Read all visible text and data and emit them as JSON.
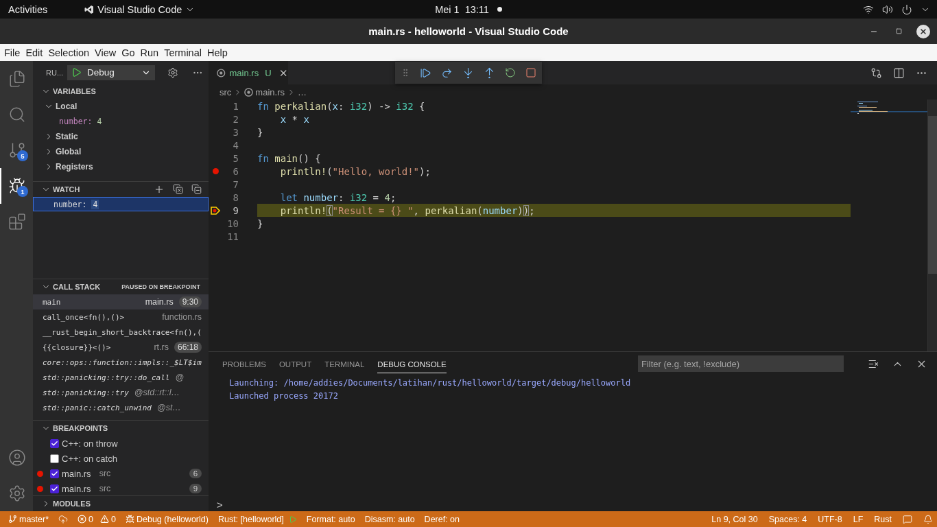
{
  "topbar": {
    "activities": "Activities",
    "app": "Visual Studio Code",
    "clock": "Mei 1  13:11"
  },
  "window": {
    "title": "main.rs - helloworld - Visual Studio Code"
  },
  "menu": [
    "File",
    "Edit",
    "Selection",
    "View",
    "Go",
    "Run",
    "Terminal",
    "Help"
  ],
  "activity_bar": [
    {
      "kind": "explorer",
      "selected": false
    },
    {
      "kind": "search",
      "selected": false
    },
    {
      "kind": "scm",
      "selected": false,
      "badge": "5"
    },
    {
      "kind": "debug",
      "selected": true,
      "badge": "1"
    },
    {
      "kind": "extensions",
      "selected": false
    }
  ],
  "sidebar": {
    "run_label": "RU...",
    "config": "Debug",
    "variables": {
      "title": "VARIABLES",
      "expanded": true,
      "scopes": [
        {
          "label": "Local",
          "expanded": true,
          "children": [
            {
              "name": "number:",
              "value": "4"
            }
          ]
        },
        {
          "label": "Static",
          "expanded": false
        },
        {
          "label": "Global",
          "expanded": false
        },
        {
          "label": "Registers",
          "expanded": false
        }
      ]
    },
    "watch": {
      "title": "WATCH",
      "expanded": true,
      "items": [
        {
          "name": "number:",
          "value": "4",
          "selected": true
        }
      ]
    },
    "call_stack": {
      "title": "CALL STACK",
      "expanded": true,
      "status": "PAUSED ON BREAKPOINT",
      "frames": [
        {
          "kind": "user",
          "name": "main",
          "file": "main.rs",
          "pos": "9:30",
          "selected": true
        },
        {
          "kind": "user",
          "name": "call_once<fn(),()>",
          "file": "function.rs",
          "selected": false
        },
        {
          "kind": "user",
          "name": "__rust_begin_short_backtrace<fn(),(",
          "selected": false
        },
        {
          "kind": "user",
          "name": "{{closure}}<()>",
          "file": "rt.rs",
          "pos": "66:18",
          "selected": false
        },
        {
          "kind": "external",
          "name": "core::ops::function::impls::_$LT$im",
          "selected": false
        },
        {
          "kind": "external",
          "name": "std::panicking::try::do_call",
          "file": "@",
          "selected": false
        },
        {
          "kind": "external",
          "name": "std::panicking::try",
          "file": "@std::rt::l…",
          "selected": false
        },
        {
          "kind": "external",
          "name": "std::panic::catch_unwind",
          "file": "@st…",
          "selected": false
        }
      ]
    },
    "breakpoints": {
      "title": "BREAKPOINTS",
      "expanded": true,
      "items": [
        {
          "kind": "exception",
          "label": "C++: on throw",
          "checked": true
        },
        {
          "kind": "exception",
          "label": "C++: on catch",
          "checked": false
        },
        {
          "kind": "file",
          "label": "main.rs",
          "path": "src",
          "line": "6",
          "checked": true
        },
        {
          "kind": "file",
          "label": "main.rs",
          "path": "src",
          "line": "9",
          "checked": true
        }
      ]
    },
    "modules": {
      "title": "MODULES",
      "expanded": false
    }
  },
  "editor": {
    "tab": {
      "name": "main.rs",
      "status": "U"
    },
    "breadcrumb": [
      "src",
      "main.rs",
      "…"
    ],
    "lines": [
      {
        "no": "1",
        "breakpoint": false,
        "current": false,
        "tokens": [
          {
            "text": "fn ",
            "kind": "kw"
          },
          {
            "text": "perkalian",
            "kind": "fn"
          },
          {
            "text": "(",
            "kind": "p"
          },
          {
            "text": "x",
            "kind": "var"
          },
          {
            "text": ": ",
            "kind": "p"
          },
          {
            "text": "i32",
            "kind": "type"
          },
          {
            "text": ") -> ",
            "kind": "p"
          },
          {
            "text": "i32",
            "kind": "type"
          },
          {
            "text": " {",
            "kind": "p"
          }
        ]
      },
      {
        "no": "2",
        "breakpoint": false,
        "current": false,
        "tokens": [
          {
            "text": "    x",
            "kind": "var"
          },
          {
            "text": " * ",
            "kind": "p"
          },
          {
            "text": "x",
            "kind": "var"
          }
        ]
      },
      {
        "no": "3",
        "breakpoint": false,
        "current": false,
        "tokens": [
          {
            "text": "}",
            "kind": "p"
          }
        ]
      },
      {
        "no": "4",
        "breakpoint": false,
        "current": false
      },
      {
        "no": "5",
        "breakpoint": false,
        "current": false,
        "tokens": [
          {
            "text": "fn ",
            "kind": "kw"
          },
          {
            "text": "main",
            "kind": "fn"
          },
          {
            "text": "() {",
            "kind": "p"
          }
        ]
      },
      {
        "no": "6",
        "breakpoint": true,
        "current": false,
        "tokens": [
          {
            "text": "    println!",
            "kind": "fn"
          },
          {
            "text": "(",
            "kind": "p"
          },
          {
            "text": "\"Hello, world!\"",
            "kind": "str"
          },
          {
            "text": ");",
            "kind": "p"
          }
        ]
      },
      {
        "no": "7",
        "breakpoint": false,
        "current": false
      },
      {
        "no": "8",
        "breakpoint": false,
        "current": false,
        "tokens": [
          {
            "text": "    let ",
            "kind": "kw"
          },
          {
            "text": "number",
            "kind": "var"
          },
          {
            "text": ": ",
            "kind": "p"
          },
          {
            "text": "i32",
            "kind": "type"
          },
          {
            "text": " = ",
            "kind": "p"
          },
          {
            "text": "4",
            "kind": "num"
          },
          {
            "text": ";",
            "kind": "p"
          }
        ]
      },
      {
        "no": "9",
        "breakpoint": true,
        "current": true,
        "tokens": [
          {
            "text": "    println!",
            "kind": "fn"
          },
          {
            "text": "(",
            "kind": "bracket"
          },
          {
            "text": "\"Result = {} \"",
            "kind": "str"
          },
          {
            "text": ", ",
            "kind": "p"
          },
          {
            "text": "perkalian",
            "kind": "fn"
          },
          {
            "text": "(",
            "kind": "p"
          },
          {
            "text": "number",
            "kind": "var"
          },
          {
            "text": ")",
            "kind": "p"
          },
          {
            "text": ")",
            "kind": "bracket"
          },
          {
            "text": ";",
            "kind": "p"
          }
        ]
      },
      {
        "no": "10",
        "breakpoint": false,
        "current": false,
        "tokens": [
          {
            "text": "}",
            "kind": "p"
          }
        ]
      },
      {
        "no": "11",
        "breakpoint": false,
        "current": false
      }
    ]
  },
  "panel": {
    "tabs": [
      {
        "label": "PROBLEMS",
        "selected": false
      },
      {
        "label": "OUTPUT",
        "selected": false
      },
      {
        "label": "TERMINAL",
        "selected": false
      },
      {
        "label": "DEBUG CONSOLE",
        "selected": true
      }
    ],
    "filter": {
      "placeholder": "Filter (e.g. text, !exclude)"
    },
    "console": [
      "Launching: /home/addies/Documents/latihan/rust/helloworld/target/debug/helloworld",
      "Launched process 20172"
    ],
    "prompt": ">"
  },
  "status_bar": {
    "left": [
      {
        "kind": "branch",
        "text": "master*"
      },
      {
        "kind": "sync"
      },
      {
        "kind": "problems",
        "errors": "0",
        "warnings": "0"
      },
      {
        "kind": "debug",
        "text": "Debug (helloworld)"
      },
      {
        "kind": "run",
        "text": "Rust: [helloworld]"
      },
      {
        "kind": "text",
        "text": "Format: auto"
      },
      {
        "kind": "text",
        "text": "Disasm: auto"
      },
      {
        "kind": "text",
        "text": "Deref: on"
      }
    ],
    "right": [
      {
        "kind": "text",
        "text": "Ln 9, Col 30"
      },
      {
        "kind": "text",
        "text": "Spaces: 4"
      },
      {
        "kind": "text",
        "text": "UTF-8"
      },
      {
        "kind": "text",
        "text": "LF"
      },
      {
        "kind": "text",
        "text": "Rust"
      },
      {
        "kind": "feedback"
      },
      {
        "kind": "bell"
      }
    ]
  }
}
